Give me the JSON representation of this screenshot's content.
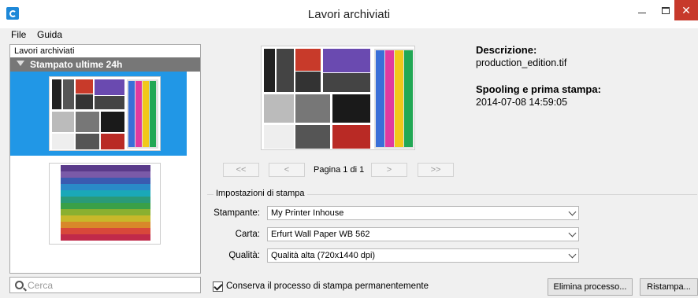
{
  "window": {
    "title": "Lavori archiviati"
  },
  "menu": {
    "file": "File",
    "help": "Guida"
  },
  "tree": {
    "root": "Lavori archiviati",
    "group": "Stampato ultime 24h"
  },
  "search": {
    "placeholder": "Cerca"
  },
  "details": {
    "description_label": "Descrizione:",
    "description_value": "production_edition.tif",
    "spool_label": "Spooling e prima stampa:",
    "spool_value": "2014-07-08 14:59:05"
  },
  "pager": {
    "first": "<<",
    "prev": "<",
    "info": "Pagina 1 di 1",
    "next": ">",
    "last": ">>"
  },
  "settings": {
    "title": "Impostazioni di stampa",
    "printer_label": "Stampante:",
    "printer_value": "My Printer Inhouse",
    "paper_label": "Carta:",
    "paper_value": "Erfurt Wall Paper WB 562",
    "quality_label": "Qualità:",
    "quality_value": "Qualità alta (720x1440 dpi)"
  },
  "footer": {
    "keep_label": "Conserva il processo di stampa permanentemente",
    "keep_checked": true,
    "delete_button": "Elimina processo...",
    "reprint_button": "Ristampa..."
  },
  "colors": {
    "selection": "#2197e6",
    "close": "#c7392b",
    "group_header": "#777777"
  }
}
